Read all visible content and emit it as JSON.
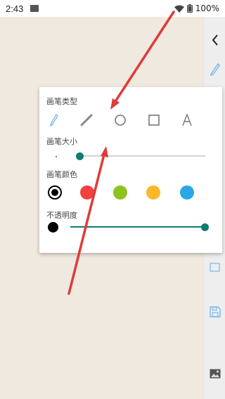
{
  "status_bar": {
    "time": "2:43",
    "battery": "100%"
  },
  "pen_panel": {
    "type_title": "画笔类型",
    "size_title": "画笔大小",
    "color_title": "画笔颜色",
    "opacity_title": "不透明度",
    "tools": [
      "pencil",
      "line",
      "circle",
      "rectangle",
      "text"
    ],
    "selected_tool": "pencil",
    "size_level": 0.0,
    "opacity_level": 1.0,
    "colors": [
      "#000000",
      "#f24141",
      "#8dc21f",
      "#fbb829",
      "#2aa7e6"
    ],
    "selected_color": "#000000",
    "accent": "#0d7d6e"
  },
  "annotation_color": "#e03b3b"
}
